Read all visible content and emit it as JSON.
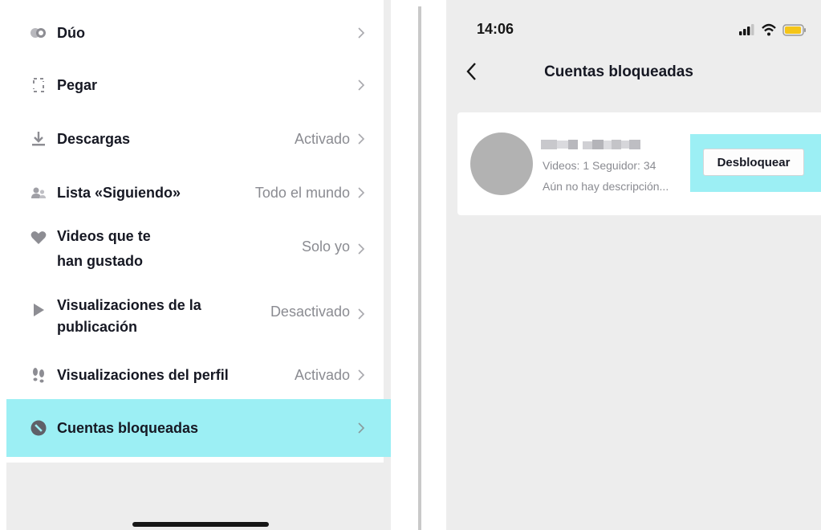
{
  "left": {
    "menu": [
      {
        "icon": "duet-icon",
        "label": "Dúo",
        "value": ""
      },
      {
        "icon": "stitch-icon",
        "label": "Pegar",
        "value": ""
      },
      {
        "icon": "download-icon",
        "label": "Descargas",
        "value": "Activado"
      },
      {
        "icon": "following-list-icon",
        "label": "Lista «Siguiendo»",
        "value": "Todo el mundo"
      },
      {
        "icon": "heart-icon",
        "label": "Videos que te",
        "label2": "han gustado",
        "value": "Solo yo"
      },
      {
        "icon": "play-icon",
        "label": "Visualizaciones de la",
        "label2": "publicación",
        "value": "Desactivado"
      },
      {
        "icon": "footprints-icon",
        "label": "Visualizaciones del perfil",
        "value": "Activado"
      },
      {
        "icon": "blocked-icon",
        "label": "Cuentas bloqueadas",
        "value": ""
      }
    ]
  },
  "right": {
    "status_time": "14:06",
    "title": "Cuentas bloqueadas",
    "user": {
      "stats": "Videos: 1  Seguidor: 34",
      "description": "Aún no hay descripción...",
      "unblock_label": "Desbloquear"
    }
  },
  "colors": {
    "highlight": "#9ceff4",
    "panel_bg": "#ededed",
    "text_primary": "#161823",
    "text_secondary": "#8a8b91"
  }
}
